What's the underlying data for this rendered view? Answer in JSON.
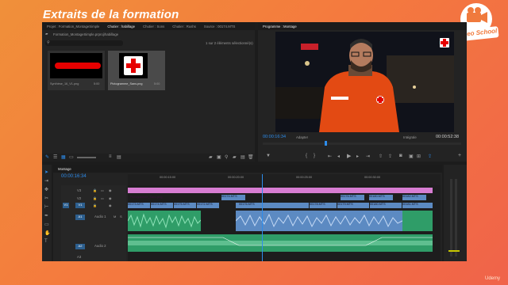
{
  "slide": {
    "title": "Extraits de la formation",
    "watermark": "Udemy"
  },
  "logo": {
    "text": "Video School"
  },
  "project_panel": {
    "tabs": [
      "Projet : Formation_MontageSimple",
      "Chutier : habillage",
      "Chutier : Sons",
      "Chutier : Rushs",
      "Source : 00174.MTS"
    ],
    "active_tab": 1,
    "path": "Formation_MontageSimple.prproj\\habillage",
    "selection_info": "1 sur 2 éléments sélectionné(s)",
    "items": [
      {
        "name": "Synthèse_16_V1.png",
        "duration": "5:00"
      },
      {
        "name": "Pictogramme_Sans.png",
        "duration": "5:00"
      }
    ]
  },
  "program_monitor": {
    "tab": "Programme : Montage",
    "timecode": "00:00:16:34",
    "fit": "Adapter",
    "quality": "Intégrale",
    "duration": "00:00:52:38"
  },
  "timeline": {
    "tab": "Montage",
    "timecode": "00:00:16:34",
    "ruler": [
      "00:00:15:00",
      "00:00:20:00",
      "00:00:25:00",
      "00:00:30:00"
    ],
    "tracks": [
      "V3",
      "V2",
      "V1",
      "A1",
      "A2",
      "A3"
    ],
    "audio_labels": [
      "Audio 1",
      "Audio 2"
    ],
    "clip_labels": {
      "v3_graphic": "Pictogramme_Sans.png",
      "v1_clips": [
        "00173.MTS",
        "00174.MTS",
        "00175.MTS",
        "00172.MTS",
        "00176.MTS",
        "00178.MTS",
        "00179.MTS",
        "00180.MTS",
        "00181.MTS"
      ],
      "v2_clips": [
        "00174.MTS",
        "00176.MTS",
        "00180.MTS",
        "00182.MTS"
      ]
    }
  },
  "colors": {
    "accent": "#2d8ceb",
    "graphic_clip": "#d77dd2",
    "video_clip": "#5c8ac2",
    "audio_clip": "#2f9d68"
  }
}
